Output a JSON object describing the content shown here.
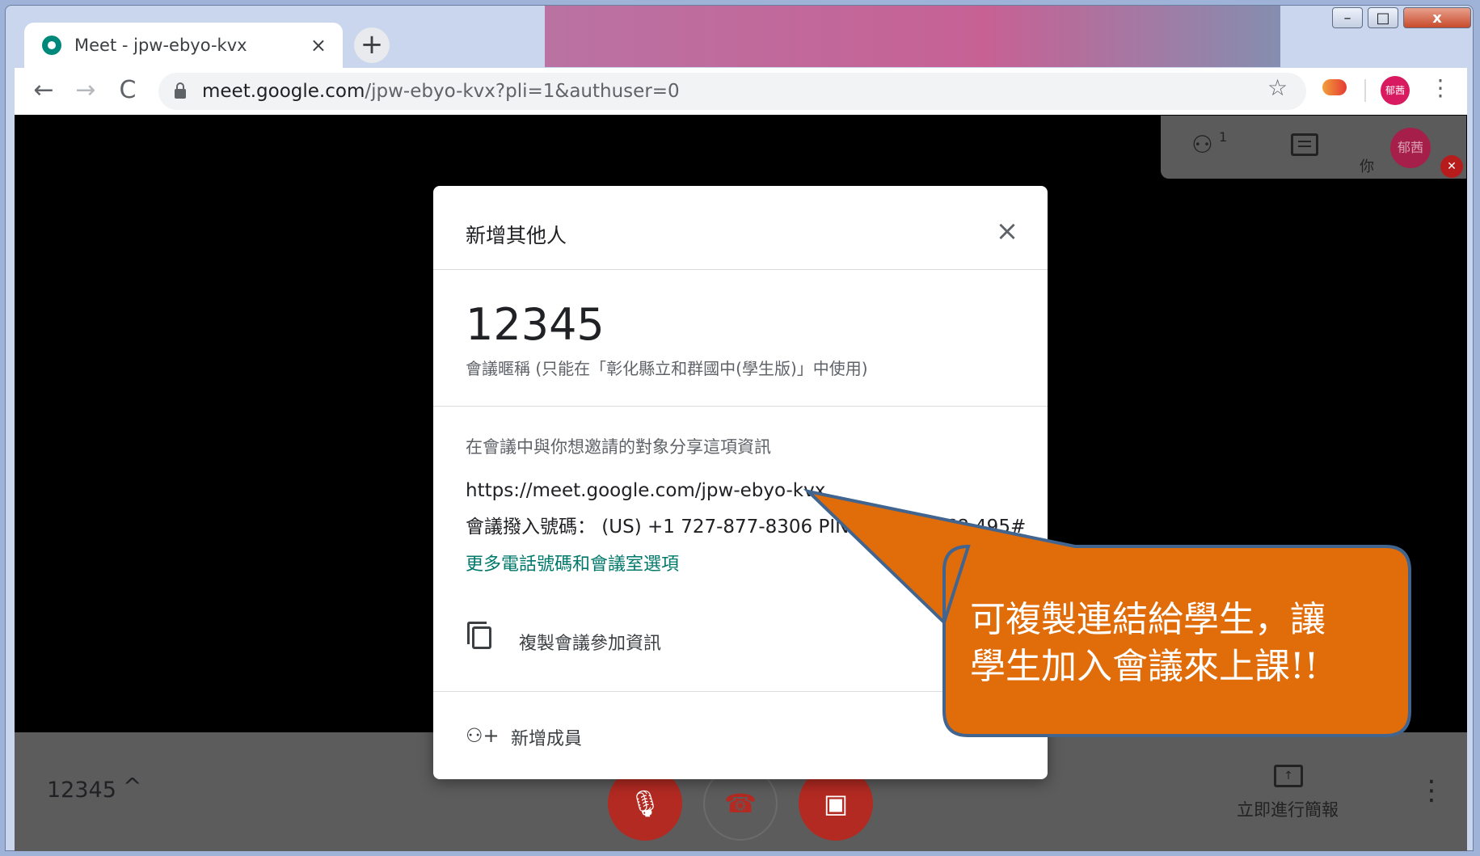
{
  "window_controls": {
    "minimize": "–",
    "maximize": "□",
    "close": "x"
  },
  "browser": {
    "tab_title": "Meet - jpw-ebyo-kvx",
    "tab_close": "×",
    "new_tab": "+",
    "url_host": "meet.google.com",
    "url_path": "/jpw-ebyo-kvx?pli=1&authuser=0",
    "profile_label": "郁茜",
    "icons": {
      "back": "←",
      "forward": "→",
      "reload": "C",
      "star": "☆",
      "menu": "⋮"
    }
  },
  "meet": {
    "participants_count": "1",
    "you_label": "你",
    "self_avatar_label": "郁茜",
    "meeting_code": "12345",
    "code_chevron": "^",
    "present_label": "立即進行簡報",
    "present_icon": "↑",
    "more": "⋮",
    "mic_icon": "🎙",
    "hangup_icon": "☎",
    "camera_icon": "▣"
  },
  "dialog": {
    "title": "新增其他人",
    "close": "×",
    "nickname": "12345",
    "nickname_caption": "會議暱稱 (只能在「彰化縣立和群國中(學生版)」中使用)",
    "share_hint": "在會議中與你想邀請的對象分享這項資訊",
    "meeting_link": "https://meet.google.com/jpw-ebyo-kvx",
    "dial_in": "會議撥入號碼： (US) +1 727-877-8306  PIN 碼：367 768 495#",
    "more_options_link": "更多電話號碼和會議室選項",
    "copy_label": "複製會議參加資訊",
    "add_member_label": "新增成員",
    "add_member_icon": "⚇+"
  },
  "callout": {
    "text_line1": "可複製連結給學生，讓",
    "text_line2": "學生加入會議來上課!!",
    "fill_color": "#e06c0a",
    "border_color": "#41658f"
  }
}
